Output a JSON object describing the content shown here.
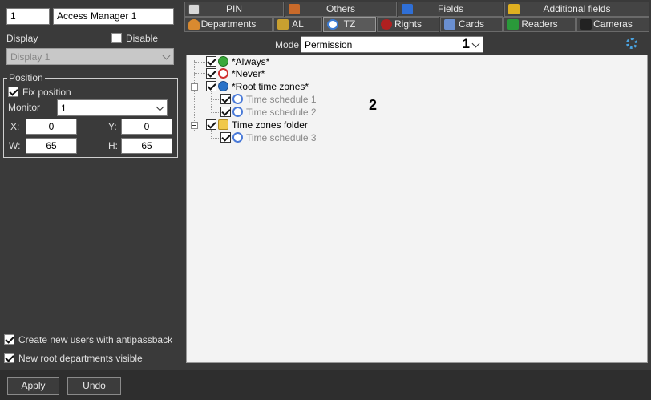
{
  "left": {
    "id_value": "1",
    "name_value": "Access Manager 1",
    "display_label": "Display",
    "disable_label": "Disable",
    "disable_checked": false,
    "display_select": "Display 1",
    "position": {
      "legend": "Position",
      "fix_label": "Fix position",
      "fix_checked": true,
      "monitor_label": "Monitor",
      "monitor_value": "1",
      "x_label": "X:",
      "x_value": "0",
      "y_label": "Y:",
      "y_value": "0",
      "w_label": "W:",
      "w_value": "65",
      "h_label": "H:",
      "h_value": "65"
    },
    "antipassback_label": "Create new users with antipassback",
    "antipassback_checked": true,
    "root_depts_label": "New root departments visible",
    "root_depts_checked": true
  },
  "buttons": {
    "apply": "Apply",
    "undo": "Undo"
  },
  "tabs_row1": [
    {
      "label": "PIN",
      "icon": "pin-icon"
    },
    {
      "label": "Others",
      "icon": "others-icon"
    },
    {
      "label": "Fields",
      "icon": "fields-icon"
    },
    {
      "label": "Additional fields",
      "icon": "additional-fields-icon"
    }
  ],
  "tabs_row2": [
    {
      "label": "Departments",
      "icon": "departments-icon"
    },
    {
      "label": "AL",
      "icon": "lock-icon"
    },
    {
      "label": "TZ",
      "icon": "clock-icon",
      "active": true
    },
    {
      "label": "Rights",
      "icon": "rights-icon"
    },
    {
      "label": "Cards",
      "icon": "card-icon"
    },
    {
      "label": "Readers",
      "icon": "reader-icon"
    },
    {
      "label": "Cameras",
      "icon": "camera-icon"
    }
  ],
  "toolbar": {
    "mode_label": "Mode",
    "mode_value": "Permission",
    "marker1": "1"
  },
  "content": {
    "marker2": "2"
  },
  "tree": [
    {
      "label": "*Always*",
      "icon": "green-clock-icon",
      "checked": true,
      "dim": false
    },
    {
      "label": "*Never*",
      "icon": "red-clock-icon",
      "checked": true,
      "dim": false
    },
    {
      "label": "*Root time zones*",
      "icon": "globe-icon",
      "checked": true,
      "dim": false
    },
    {
      "label": "Time schedule 1",
      "icon": "blue-clock-icon",
      "checked": true,
      "dim": true
    },
    {
      "label": "Time schedule 2",
      "icon": "blue-clock-icon",
      "checked": true,
      "dim": true
    },
    {
      "label": "Time zones folder",
      "icon": "folder-icon",
      "checked": true,
      "dim": false
    },
    {
      "label": "Time schedule 3",
      "icon": "blue-clock-icon",
      "checked": true,
      "dim": true
    }
  ],
  "colors": {
    "panel_bg": "#3a3a3a",
    "content_bg": "#f3f3f3",
    "settings_gear": "#4aa3e0"
  }
}
